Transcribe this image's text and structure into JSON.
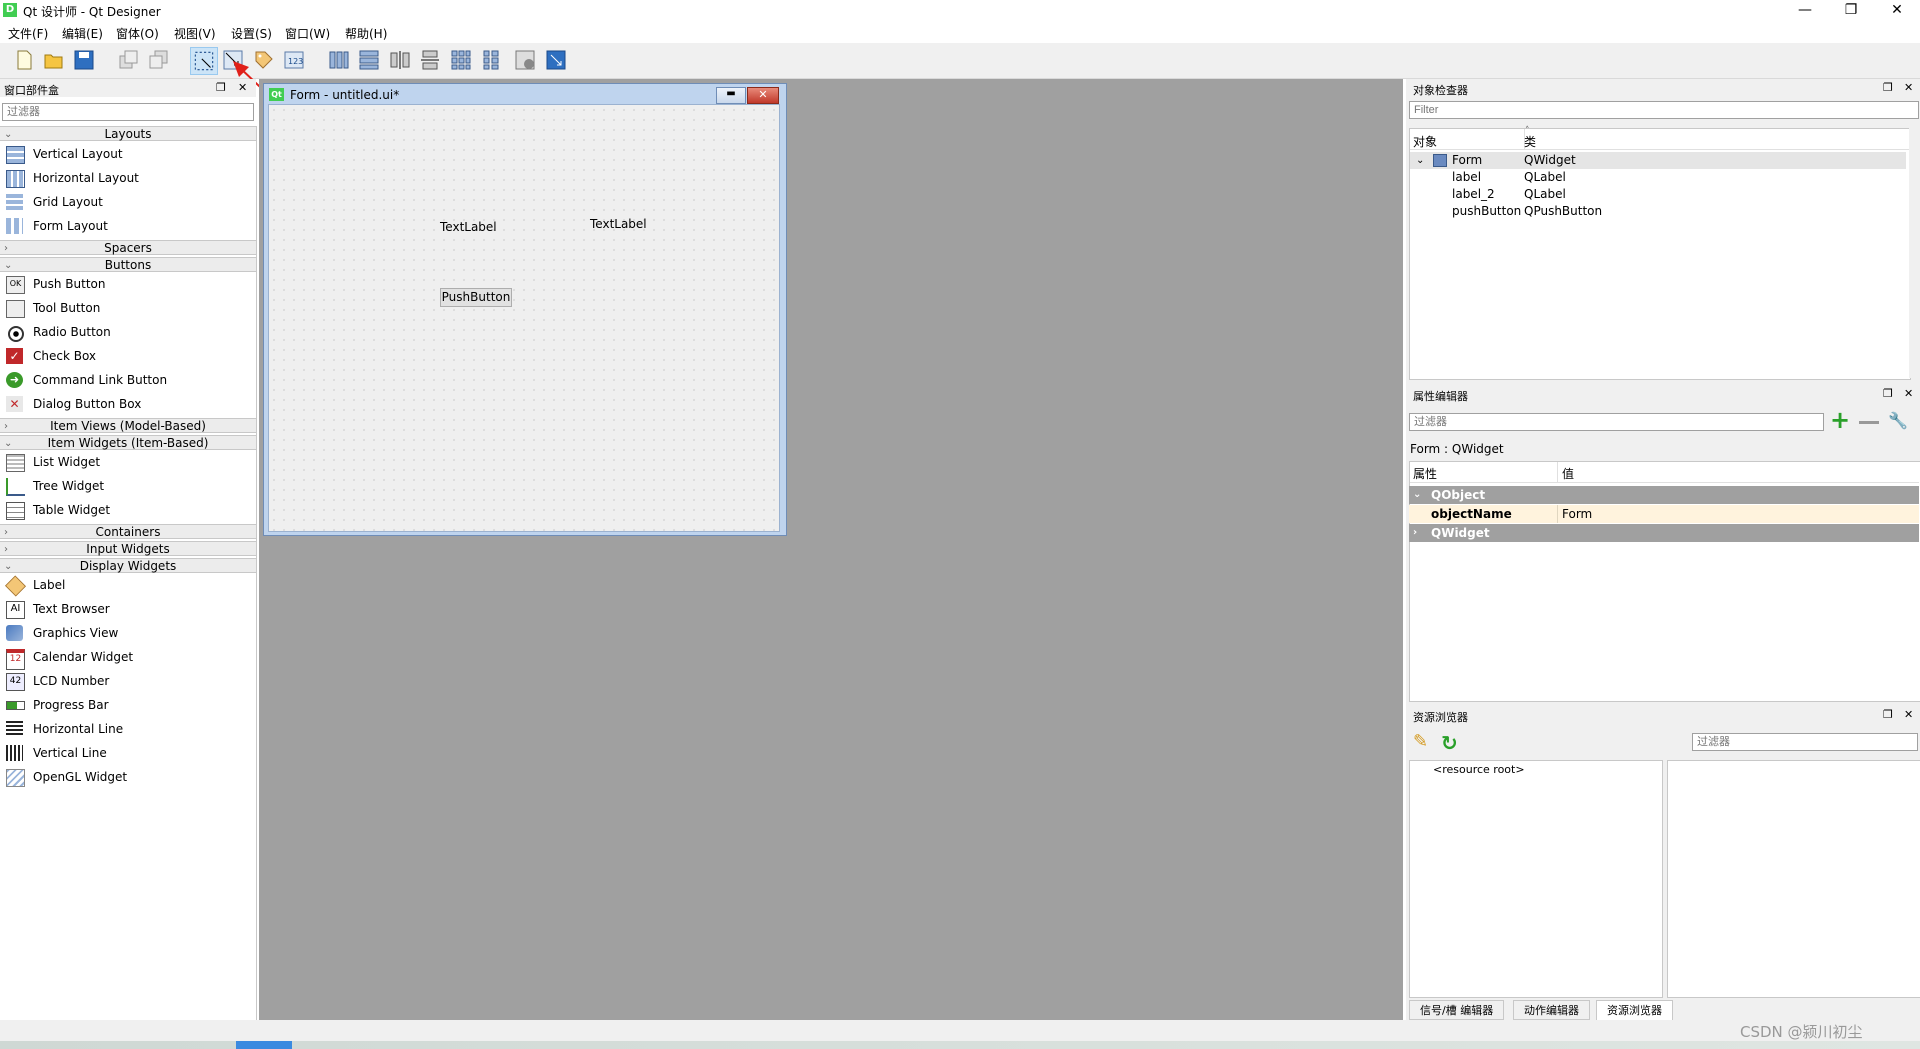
{
  "window": {
    "app_icon_text": "D",
    "title": "Qt 设计师 - Qt Designer",
    "minimize": "—",
    "restore": "❐",
    "close": "✕"
  },
  "menu": [
    "文件(F)",
    "编辑(E)",
    "窗体(O)",
    "视图(V)",
    "设置(S)",
    "窗口(W)",
    "帮助(H)"
  ],
  "toolbar": {
    "icons": [
      "new-form-icon",
      "open-form-icon",
      "save-form-icon",
      "bring-to-front-icon",
      "send-to-back-icon",
      "edit-widgets-icon",
      "edit-signals-slots-icon",
      "edit-buddies-icon",
      "edit-tab-order-icon",
      "lay-out-horizontally-icon",
      "lay-out-vertically-icon",
      "lay-out-horizontally-splitter-icon",
      "lay-out-vertically-splitter-icon",
      "lay-out-grid-icon",
      "lay-out-form-icon",
      "break-layout-icon",
      "adjust-size-icon"
    ]
  },
  "widget_box": {
    "title": "窗口部件盒",
    "filter_placeholder": "过滤器",
    "categories": {
      "layouts": "Layouts",
      "spacers": "Spacers",
      "buttons": "Buttons",
      "item_views": "Item Views (Model-Based)",
      "item_widgets": "Item Widgets (Item-Based)",
      "containers": "Containers",
      "input_widgets": "Input Widgets",
      "display_widgets": "Display Widgets"
    },
    "layouts": [
      "Vertical Layout",
      "Horizontal Layout",
      "Grid Layout",
      "Form Layout"
    ],
    "buttons": [
      "Push Button",
      "Tool Button",
      "Radio Button",
      "Check Box",
      "Command Link Button",
      "Dialog Button Box"
    ],
    "item_widgets": [
      "List Widget",
      "Tree Widget",
      "Table Widget"
    ],
    "display_widgets": [
      "Label",
      "Text Browser",
      "Graphics View",
      "Calendar Widget",
      "LCD Number",
      "Progress Bar",
      "Horizontal Line",
      "Vertical Line",
      "OpenGL Widget"
    ]
  },
  "form": {
    "icon_text": "Qt",
    "title": "Form - untitled.ui*",
    "label1": "TextLabel",
    "label2": "TextLabel",
    "button": "PushButton"
  },
  "object_inspector": {
    "title": "对象检查器",
    "filter_placeholder": "Filter",
    "col_object": "对象",
    "col_class": "类",
    "rows": [
      {
        "object": "Form",
        "class": "QWidget"
      },
      {
        "object": "label",
        "class": "QLabel"
      },
      {
        "object": "label_2",
        "class": "QLabel"
      },
      {
        "object": "pushButton",
        "class": "QPushButton"
      }
    ]
  },
  "property_editor": {
    "title": "属性编辑器",
    "filter_placeholder": "过滤器",
    "context": "Form : QWidget",
    "col_property": "属性",
    "col_value": "值",
    "group1": "QObject",
    "prop_name": "objectName",
    "prop_value": "Form",
    "group2": "QWidget"
  },
  "resource_browser": {
    "title": "资源浏览器",
    "filter_placeholder": "过滤器",
    "root": "<resource root>"
  },
  "bottom_tabs": [
    "信号/槽 编辑器",
    "动作编辑器",
    "资源浏览器"
  ],
  "watermark": "CSDN @颍川初尘",
  "colors": {
    "accent_selected": "#cce4f7",
    "property_group": "#a0a0a0",
    "property_highlight": "#fff3dd",
    "mdi_background": "#a0a0a0"
  }
}
